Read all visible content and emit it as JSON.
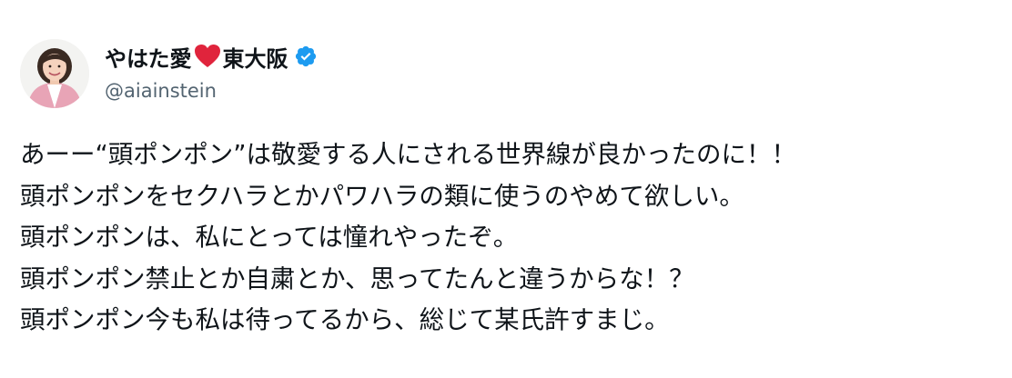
{
  "author": {
    "name_prefix": "やはた愛",
    "name_suffix": "東大阪",
    "handle": "@aiainstein",
    "verified": true,
    "verified_color": "#1d9bf0"
  },
  "tweet": {
    "lines": [
      "あーー“頭ポンポン”は敬愛する人にされる世界線が良かったのに！！",
      "頭ポンポンをセクハラとかパワハラの類に使うのやめて欲しい。",
      "頭ポンポンは、私にとっては憧れやったぞ。",
      "頭ポンポン禁止とか自粛とか、思ってたんと違うからな！？",
      "頭ポンポン今も私は待ってるから、総じて某氏許すまじ。"
    ]
  },
  "icons": {
    "heart": "red-heart-icon",
    "verified": "verified-badge-icon",
    "avatar": "profile-photo"
  }
}
